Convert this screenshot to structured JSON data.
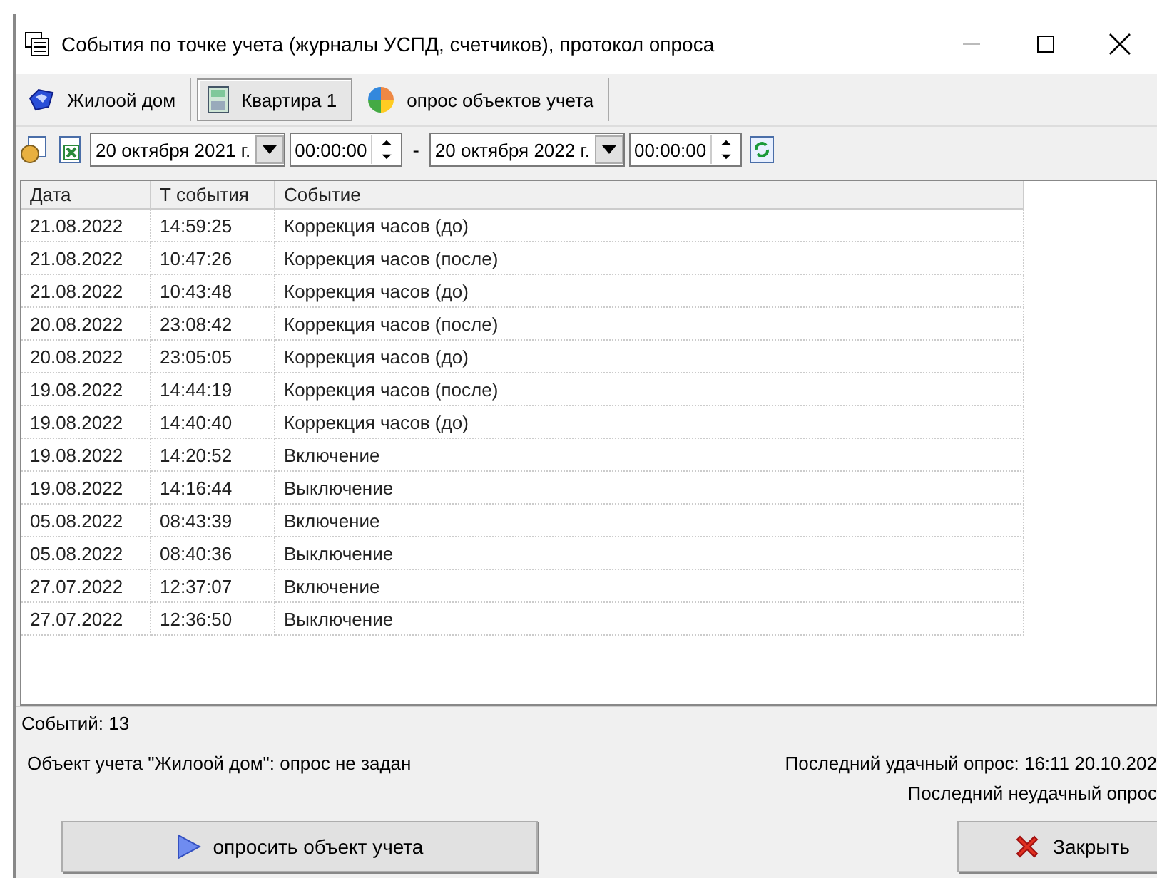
{
  "window": {
    "title": "События по точке учета (журналы УСПД, счетчиков), протокол опроса"
  },
  "tabs": [
    {
      "label": "Жилоой дом",
      "kind": "house",
      "selected": false
    },
    {
      "label": "Квартира 1",
      "kind": "meter",
      "selected": true
    },
    {
      "label": "опрос объектов учета",
      "kind": "pie",
      "selected": false
    }
  ],
  "filter": {
    "date_from": "20  октября  2021 г.",
    "time_from": "00:00:00",
    "separator": "-",
    "date_to": "20  октября  2022 г.",
    "time_to": "00:00:00"
  },
  "table": {
    "columns": [
      "Дата",
      "Т события",
      "Событие"
    ],
    "rows": [
      [
        "21.08.2022",
        "14:59:25",
        "Коррекция часов (до)"
      ],
      [
        "21.08.2022",
        "10:47:26",
        "Коррекция часов (после)"
      ],
      [
        "21.08.2022",
        "10:43:48",
        "Коррекция часов (до)"
      ],
      [
        "20.08.2022",
        "23:08:42",
        "Коррекция часов (после)"
      ],
      [
        "20.08.2022",
        "23:05:05",
        "Коррекция часов (до)"
      ],
      [
        "19.08.2022",
        "14:44:19",
        "Коррекция часов (после)"
      ],
      [
        "19.08.2022",
        "14:40:40",
        "Коррекция часов (до)"
      ],
      [
        "19.08.2022",
        "14:20:52",
        "Включение"
      ],
      [
        "19.08.2022",
        "14:16:44",
        "Выключение"
      ],
      [
        "05.08.2022",
        "08:43:39",
        "Включение"
      ],
      [
        "05.08.2022",
        "08:40:36",
        "Выключение"
      ],
      [
        "27.07.2022",
        "12:37:07",
        "Включение"
      ],
      [
        "27.07.2022",
        "12:36:50",
        "Выключение"
      ]
    ]
  },
  "status_bar": "Событий: 13",
  "info": {
    "left": "Объект учета \"Жилоой дом\": опрос не задан",
    "last_success": "Последний удачный опрос: 16:11 20.10.202",
    "last_fail": "Последний неудачный опрос"
  },
  "buttons": [
    {
      "label": "опросить объект учета",
      "kind": "poll"
    },
    {
      "label": "Закрыть",
      "kind": "close"
    }
  ]
}
